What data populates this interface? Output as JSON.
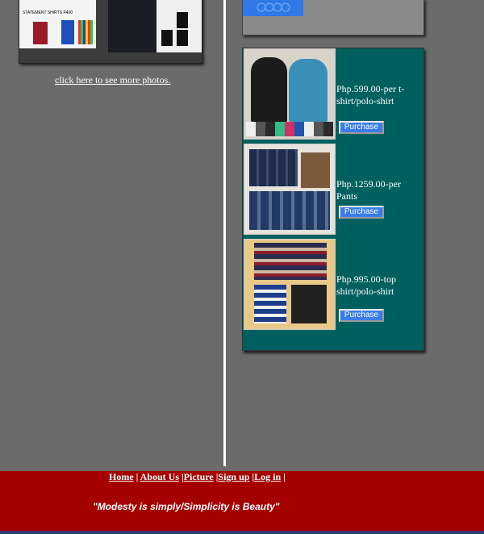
{
  "left_panel": {
    "image_text_1": "STATEMENT SHIRTS P400",
    "more_link": "click here to see more photos."
  },
  "products": [
    {
      "price_text": "Php.599.00-per t-shirt/polo-shirt",
      "button": "Purchase"
    },
    {
      "price_text": "Php.1259.00-per Pants",
      "button": "Purchase"
    },
    {
      "price_text": "Php.995.00-top shirt/polo-shirt",
      "button": "Purchase"
    }
  ],
  "footer": {
    "nav": [
      "Home",
      "About Us",
      "Picture",
      "Sign up",
      "Log in"
    ],
    "slogan": "\"Modesty is simply/Simplicity is Beauty\""
  },
  "colors": {
    "page_bg": "#6b6b6b",
    "products_bg": "#005f5f",
    "footer_bg": "#a50000",
    "button_bg": "#3a7de8"
  }
}
